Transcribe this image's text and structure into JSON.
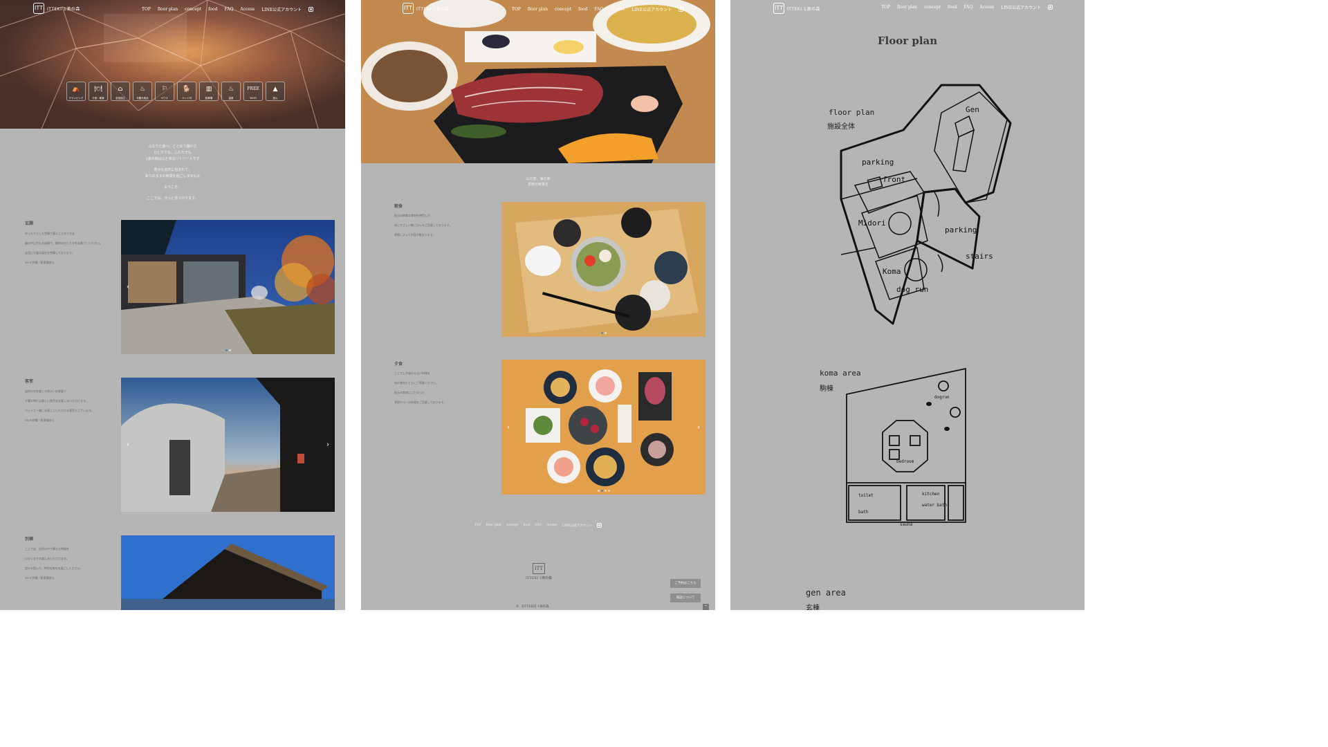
{
  "nav": {
    "logo_text": "ITTEKI 1滴の森",
    "logo_mark": "ITT",
    "links": [
      "TOP",
      "floor plan",
      "concept",
      "food",
      "FAQ",
      "Access",
      "LINE公式アカウント"
    ]
  },
  "panel1": {
    "amenities": [
      {
        "icon": "⛺",
        "label": "グランピング"
      },
      {
        "icon": "🍽",
        "label": "夕食・朝食"
      },
      {
        "icon": "⌂",
        "label": "全室独立"
      },
      {
        "icon": "♨",
        "label": "半露天風呂"
      },
      {
        "icon": "⚐",
        "label": "サウナ"
      },
      {
        "icon": "🐕",
        "label": "ペット可"
      },
      {
        "icon": "▥",
        "label": "駐車場"
      },
      {
        "icon": "♨",
        "label": "温泉"
      },
      {
        "icon": "FREE",
        "label": "Wi-Fi"
      },
      {
        "icon": "▲",
        "label": "焚火"
      }
    ],
    "intro": [
      [
        "ふらりと森へ、ととのう静けさ",
        "ひとりでも、ふたりでも",
        "1滴の森は心と体のリトリートです"
      ],
      [
        "豊かな自然に包まれて、",
        "ありのままの時間を過ごしませんか"
      ],
      [
        "ようこそ、"
      ],
      [
        "ここでは、きっと見つかります。"
      ]
    ],
    "sections": [
      {
        "title": "玄関",
        "paragraphs": [
          "ゆったりとした空間で寛ぐことのできる",
          "森の中に佇むお部屋で、静寂のひとときをお過ごしください。",
          "全室に半露天風呂を完備しております。",
          "Wi-Fi完備・駐車場あり"
        ]
      },
      {
        "title": "客室",
        "paragraphs": [
          "自然の光を感じる明るいお部屋で",
          "夕暮れ時には美しい景色をお楽しみいただけます。",
          "ペットと一緒にお過ごしいただける客室もございます。",
          "Wi-Fi完備・駐車場あり"
        ]
      },
      {
        "title": "別棟",
        "paragraphs": [
          "ここでは、自然の中で静かな時間を",
          "心ゆくまでお楽しみいただけます。",
          "焚火を囲んで、特別な夜をお過ごしください。",
          "Wi-Fi完備・駐車場あり"
        ]
      }
    ]
  },
  "panel2": {
    "tagline": [
      "山の恵、海の幸",
      "季節の味覚を"
    ],
    "meals": [
      {
        "title": "朝食",
        "paragraphs": [
          "地元の新鮮な食材を使用した",
          "体にやさしい朝ごはんをご用意しております。",
          "季節によって内容が異なります。"
        ]
      },
      {
        "title": "夕食",
        "paragraphs": [
          "ここでしか味わえない料理を",
          "旬の食材とともにご堪能ください。",
          "地元の食材にこだわった",
          "季節のコース料理をご用意しております。"
        ]
      }
    ],
    "footer_links": [
      "TOP",
      "floor plan",
      "concept",
      "food",
      "FAQ",
      "Access",
      "LINE公式アカウント"
    ],
    "footer_logo": "ITTEKI 1滴の森",
    "buttons": [
      "ご予約はこちら",
      "施設について"
    ],
    "copyright": "© 【ITTEKI】1滴の森"
  },
  "panel3": {
    "title": "Floor plan",
    "floor_plan_label": "floor plan",
    "floor_plan_sub": "施設全体",
    "labels": [
      "Gen",
      "parking",
      "front",
      "Midori",
      "parking",
      "stairs",
      "Koma",
      "dog run"
    ],
    "koma_label": "koma area",
    "koma_sub": "駒棟",
    "koma_rooms": [
      "dogrun",
      "bedroom",
      "toilet",
      "kitchen",
      "water bath",
      "bath",
      "sauna"
    ],
    "gen_label": "gen area",
    "gen_sub": "玄棟"
  },
  "colors": {
    "page_bg": "#b5b5b5",
    "text": "#555555",
    "active_dot": "#4a8cc8"
  }
}
